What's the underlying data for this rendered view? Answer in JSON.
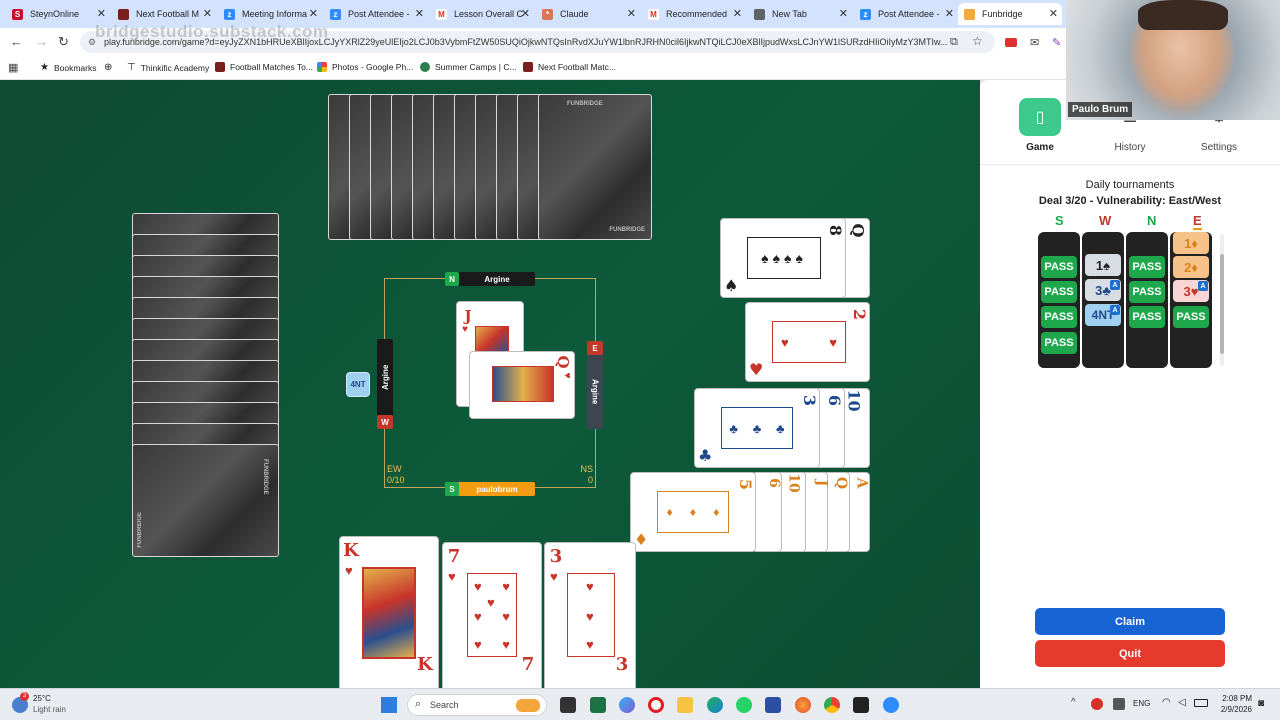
{
  "browser": {
    "tabs": [
      {
        "label": "SteynOnline",
        "color": "#c8102e",
        "fav": "S"
      },
      {
        "label": "Next Football M",
        "color": "#7a1e1e",
        "fav": ""
      },
      {
        "label": "Meeting Informa",
        "color": "#2d8cff",
        "fav": "zm"
      },
      {
        "label": "Post Attendee -",
        "color": "#2d8cff",
        "fav": "zm"
      },
      {
        "label": "Lesson Overall C",
        "color": "#d93025",
        "fav": "M"
      },
      {
        "label": "Claude",
        "color": "#d97757",
        "fav": "*"
      },
      {
        "label": "Recommended",
        "color": "#d93025",
        "fav": "M"
      },
      {
        "label": "New Tab",
        "color": "#5f6368",
        "fav": ""
      },
      {
        "label": "Post Attendee -",
        "color": "#2d8cff",
        "fav": "zm"
      },
      {
        "label": "Funbridge",
        "color": "#f2a93b",
        "fav": ""
      }
    ],
    "url": "play.funbridge.com/game?d=eyJyZXN1bHRUeXBlIjoxLCJyYXRlZ29yeUlEIjo2LCJ0b3VybmFtZW50SUQiOjkwNTQsInRvdXJuYW1lbnRJRHN0cil6IjkwNTQiLCJ0eXBlIjpudWxsLCJnYW1lSURzdHIiOiIyMzY3MTIw...",
    "watermark": "bridgestudio.substack.com",
    "bookmarks": [
      "Bookmarks",
      "Thinkific Academy",
      "Football Matches To...",
      "Photos - Google Ph...",
      "Summer Camps | C...",
      "Next Football Matc..."
    ]
  },
  "table": {
    "north_name": "Argine",
    "east_name": "Argine",
    "west_name": "Argine",
    "south_name": "paulobrum",
    "north_letter": "N",
    "east_letter": "E",
    "west_letter": "W",
    "south_letter": "S",
    "contract": "4NT",
    "ew_label": "EW",
    "ew_score": "0/10",
    "ns_label": "NS",
    "ns_score": "0",
    "brand": "FUNBRIDGE",
    "trick": [
      {
        "rank": "J",
        "suit": "♥"
      },
      {
        "rank": "Q",
        "suit": "♥"
      }
    ],
    "dummy_rows": [
      {
        "suit": "♠",
        "ranks": [
          "8",
          "Q"
        ]
      },
      {
        "suit": "♥",
        "ranks": [
          "2"
        ]
      },
      {
        "suit": "♣",
        "ranks": [
          "3",
          "6",
          "10"
        ]
      },
      {
        "suit": "♦",
        "ranks": [
          "5",
          "6",
          "10",
          "J",
          "Q",
          "A"
        ]
      }
    ],
    "south_hand": [
      {
        "rank": "K",
        "suit": "♥"
      },
      {
        "rank": "7",
        "suit": "♥"
      },
      {
        "rank": "3",
        "suit": "♥"
      }
    ]
  },
  "panel": {
    "nav": [
      {
        "label": "Game",
        "icon": "phone-icon"
      },
      {
        "label": "History",
        "icon": "history-icon"
      },
      {
        "label": "Settings",
        "icon": "settings-icon"
      }
    ],
    "tournament_title": "Daily tournaments",
    "deal_info": "Deal 3/20 - Vulnerability: East/West",
    "bid_headers": [
      "S",
      "W",
      "N",
      "E"
    ],
    "bids": {
      "S": [
        "PASS",
        "PASS",
        "PASS",
        "PASS"
      ],
      "W": [
        "1♠",
        "3♣",
        "4NT"
      ],
      "N": [
        "PASS",
        "PASS",
        "PASS"
      ],
      "E": [
        "1♦",
        "2♦",
        "3♥",
        "PASS"
      ]
    },
    "alert_mark": "A",
    "claim_label": "Claim",
    "quit_label": "Quit"
  },
  "webcam": {
    "name": "Paulo Brum"
  },
  "taskbar": {
    "temperature": "25°C",
    "weather": "Light rain",
    "search_placeholder": "Search",
    "language": "ENG",
    "time": "2:08 PM",
    "date": "2/9/2026"
  },
  "colors": {
    "table_green": "#0d5a3a",
    "pass_green": "#1ea84b",
    "claim_blue": "#1763d4",
    "quit_red": "#e53a2c",
    "seat_orange": "#f39c12",
    "accent_teal": "#3ec98c"
  }
}
